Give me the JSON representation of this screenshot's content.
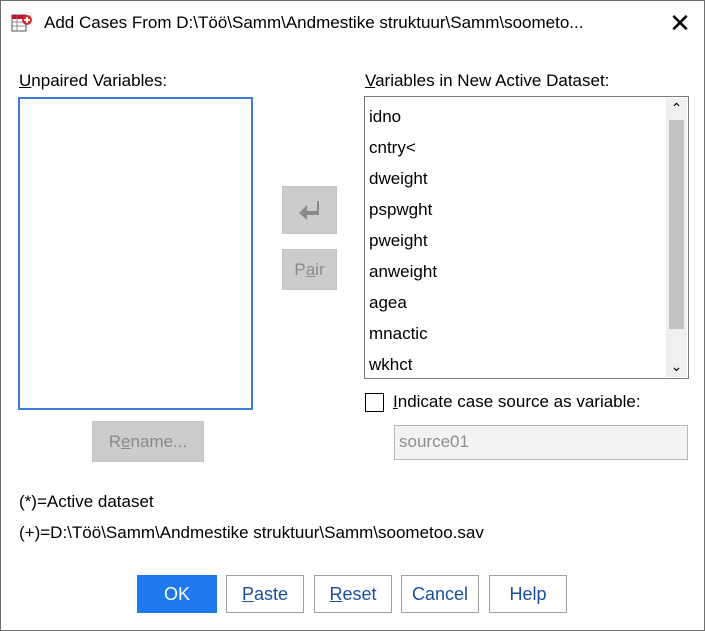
{
  "window": {
    "title": "Add Cases From D:\\Töö\\Samm\\Andmestike struktuur\\Samm\\soometo...",
    "close_glyph": "✕",
    "icon": "spss-merge-icon"
  },
  "unpaired": {
    "label_mnemonic": "U",
    "label_rest": "npaired Variables:",
    "items": []
  },
  "new_active": {
    "label_mnemonic": "V",
    "label_rest": "ariables in New Active Dataset:",
    "items": [
      "idno",
      "cntry<",
      "dweight",
      "pspwght",
      "pweight",
      "anweight",
      "agea",
      "mnactic",
      "wkhct"
    ],
    "scroll_up_glyph": "⌃",
    "scroll_down_glyph": "⌄"
  },
  "middle": {
    "move_icon": "arrow-left-icon",
    "pair_pre": "P",
    "pair_mn": "a",
    "pair_post": "ir"
  },
  "rename": {
    "pre": "R",
    "mn": "e",
    "post": "name..."
  },
  "case_source": {
    "checked": false,
    "label_mnemonic": "I",
    "label_rest": "ndicate case source as variable:",
    "value": "source01"
  },
  "legend": {
    "active": "(*)=Active dataset",
    "other": "(+)=D:\\Töö\\Samm\\Andmestike struktuur\\Samm\\soometoo.sav"
  },
  "buttons": {
    "ok": "OK",
    "paste_mn": "P",
    "paste_rest": "aste",
    "reset_mn": "R",
    "reset_rest": "eset",
    "cancel": "Cancel",
    "help": "Help"
  },
  "colors": {
    "accent": "#1e78f0",
    "link_text": "#1a4fa0",
    "disabled_bg": "#cccccc",
    "focus_border": "#3b7dd8"
  }
}
